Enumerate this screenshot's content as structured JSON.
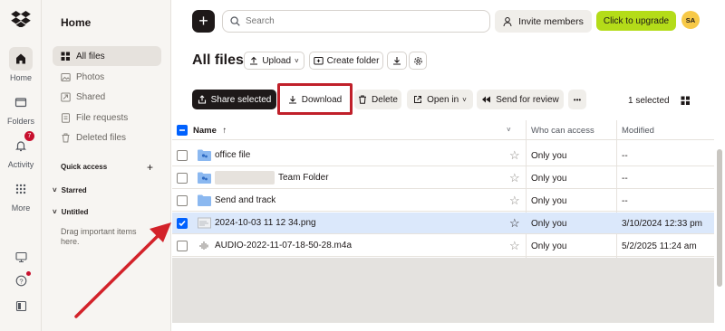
{
  "rail": {
    "items": [
      {
        "label": "Home",
        "icon": "home-icon"
      },
      {
        "label": "Folders",
        "icon": "folder-icon"
      },
      {
        "label": "Activity",
        "icon": "bell-icon",
        "badge": "7"
      },
      {
        "label": "More",
        "icon": "grid-dots-icon"
      }
    ]
  },
  "nav": {
    "title": "Home",
    "items": [
      {
        "label": "All files",
        "active": true
      },
      {
        "label": "Photos"
      },
      {
        "label": "Shared"
      },
      {
        "label": "File requests"
      },
      {
        "label": "Deleted files"
      }
    ],
    "quick_access": "Quick access",
    "starred": "Starred",
    "untitled": "Untitled",
    "note": "Drag important items here.",
    "plus": "+"
  },
  "topbar": {
    "search_placeholder": "Search",
    "invite_label": "Invite members",
    "upgrade_label": "Click to upgrade",
    "avatar_initials": "SA"
  },
  "header": {
    "title": "All files",
    "upload_label": "Upload",
    "create_folder_label": "Create folder"
  },
  "actions": {
    "share_selected": "Share selected",
    "download": "Download",
    "delete": "Delete",
    "open_in": "Open in",
    "send_for_review": "Send for review",
    "more": "•••",
    "selected_count": "1 selected"
  },
  "table": {
    "columns": {
      "name": "Name",
      "sort": "↑",
      "access": "Who can access",
      "modified": "Modified"
    },
    "rows": [
      {
        "name": "office file",
        "type": "shared-folder",
        "access": "Only you",
        "modified": "--",
        "selected": false,
        "star": "☆"
      },
      {
        "name": "Team Folder",
        "type": "shared-folder",
        "access": "Only you",
        "modified": "--",
        "selected": false,
        "star": "☆",
        "redacted": true
      },
      {
        "name": "Send and track",
        "type": "folder",
        "access": "Only you",
        "modified": "--",
        "selected": false,
        "star": "☆"
      },
      {
        "name": "2024-10-03 11 12 34.png",
        "type": "image",
        "access": "Only you",
        "modified": "3/10/2024 12:33 pm",
        "selected": true,
        "star": "☆"
      },
      {
        "name": "AUDIO-2022-11-07-18-50-28.m4a",
        "type": "audio",
        "access": "Only you",
        "modified": "5/2/2025 11:24 am",
        "selected": false,
        "star": "☆"
      }
    ]
  },
  "colors": {
    "accent": "#0061fe",
    "upgrade": "#b4dc19",
    "annotation": "#c0202a",
    "folder": "#8bb8f0"
  }
}
